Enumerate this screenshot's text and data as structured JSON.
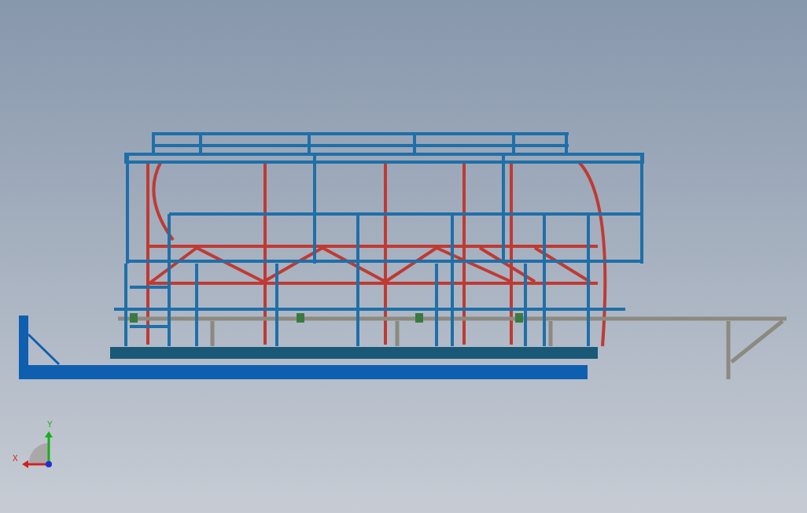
{
  "triad": {
    "axes": [
      {
        "label": "Y",
        "color": "#18b018"
      },
      {
        "label": "X",
        "color": "#d02020"
      }
    ]
  }
}
